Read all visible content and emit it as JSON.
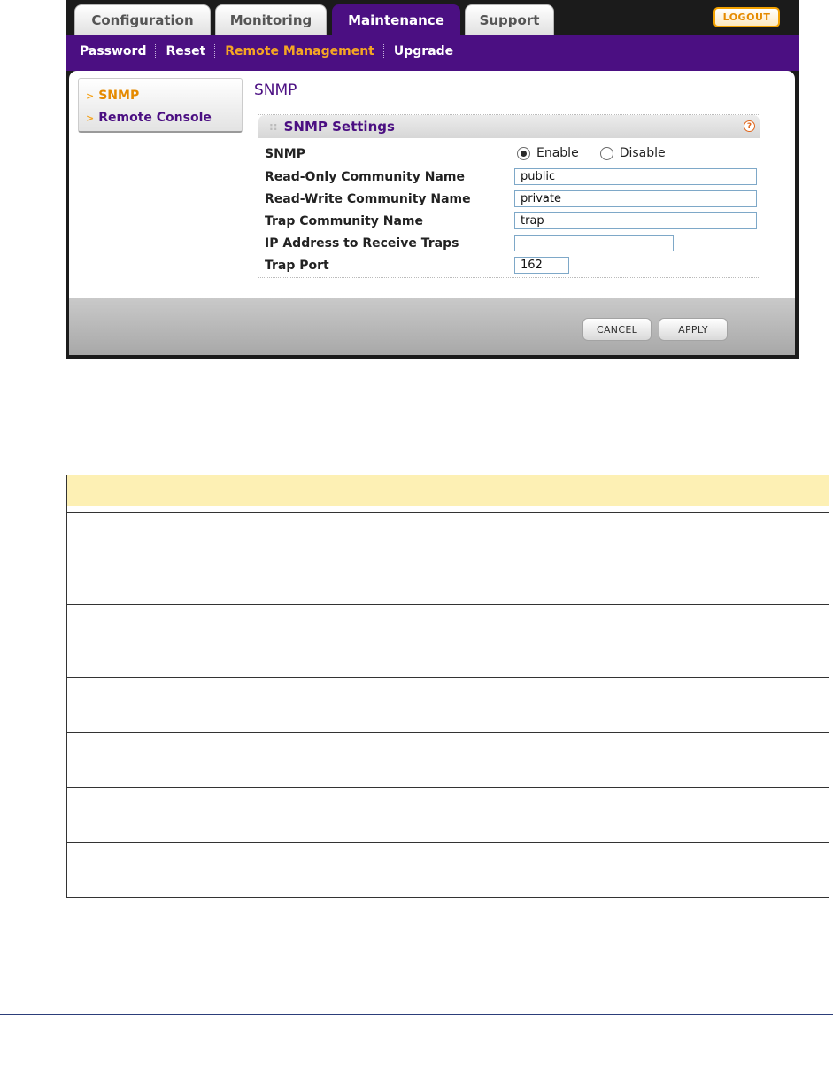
{
  "tabs": [
    {
      "label": "Configuration",
      "active": false
    },
    {
      "label": "Monitoring",
      "active": false
    },
    {
      "label": "Maintenance",
      "active": true
    },
    {
      "label": "Support",
      "active": false
    }
  ],
  "logout_label": "LOGOUT",
  "subnav": [
    {
      "label": "Password",
      "active": false
    },
    {
      "label": "Reset",
      "active": false
    },
    {
      "label": "Remote Management",
      "active": true
    },
    {
      "label": "Upgrade",
      "active": false
    }
  ],
  "sidebar": [
    {
      "label": "SNMP",
      "active": true
    },
    {
      "label": "Remote Console",
      "active": false
    }
  ],
  "page_title": "SNMP",
  "settings": {
    "title": "SNMP Settings",
    "help_glyph": "?",
    "snmp_label": "SNMP",
    "radio_enable": "Enable",
    "radio_disable": "Disable",
    "snmp_state": "enable",
    "fields": [
      {
        "label": "Read-Only Community Name",
        "value": ""
      },
      {
        "label": "Read-Write Community Name",
        "value": ""
      },
      {
        "label": "Trap Community Name",
        "value": ""
      },
      {
        "label": "IP Address to Receive Traps",
        "value": ""
      },
      {
        "label": "Trap Port",
        "value": ""
      }
    ]
  },
  "input_values": {
    "read_only": "public",
    "read_write": "private",
    "trap_community": "trap",
    "trap_ip": "",
    "trap_port": "162"
  },
  "buttons": {
    "cancel": "CANCEL",
    "apply": "APPLY"
  },
  "colors": {
    "brand_purple": "#4b0f82",
    "accent_orange": "#f5a623",
    "table_header": "#fdf0b4"
  }
}
